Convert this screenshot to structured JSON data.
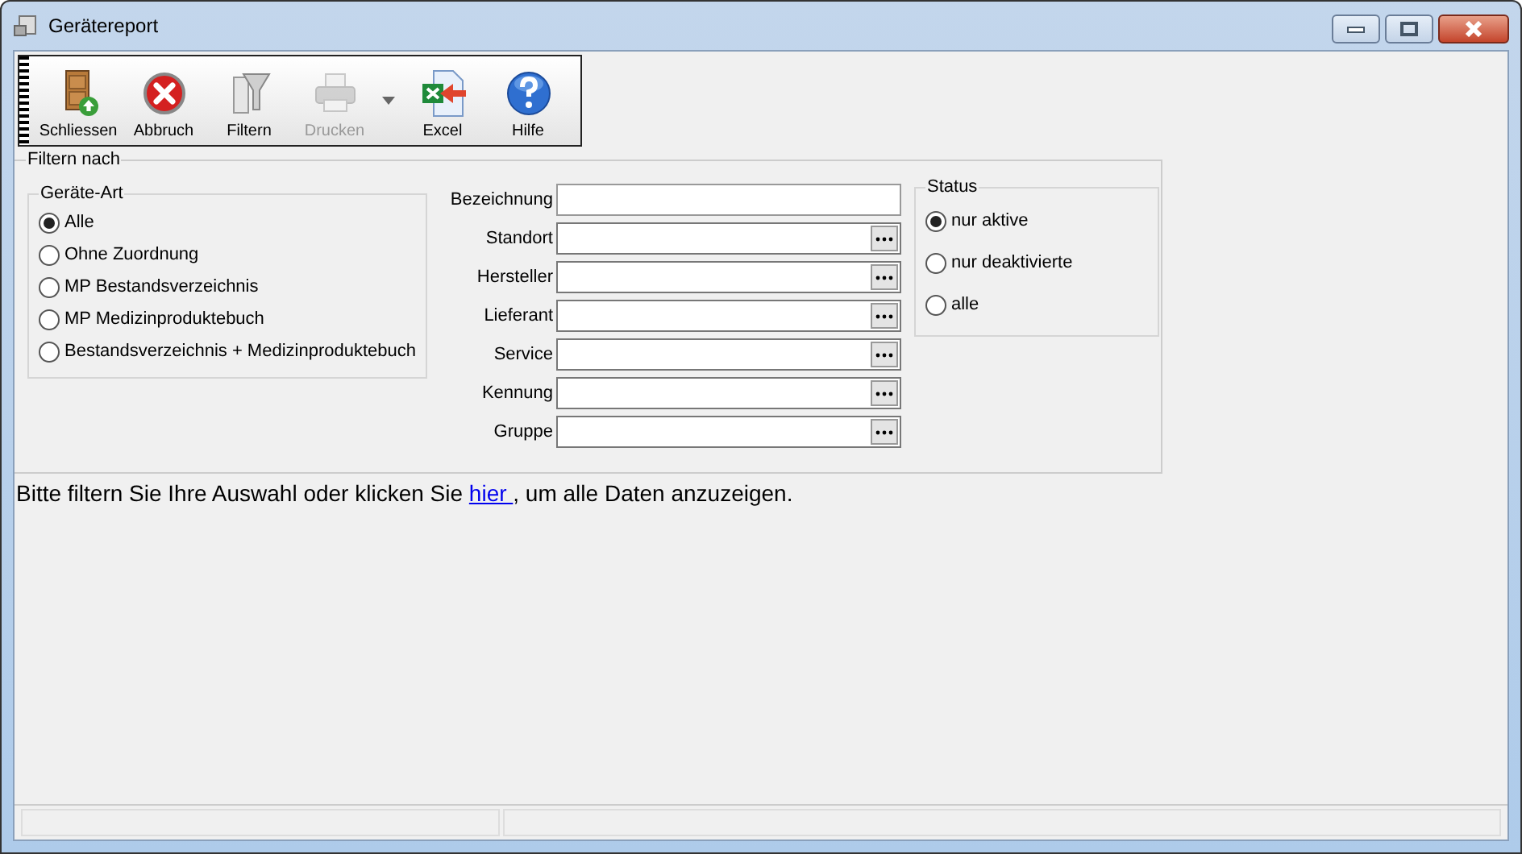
{
  "window": {
    "title": "Gerätereport"
  },
  "toolbar": [
    {
      "label": "Schliessen",
      "kind": "door",
      "disabled": false
    },
    {
      "label": "Abbruch",
      "kind": "cancel",
      "disabled": false
    },
    {
      "label": "Filtern",
      "kind": "filter",
      "disabled": false
    },
    {
      "label": "Drucken",
      "kind": "printer",
      "disabled": true
    },
    {
      "label": "Excel",
      "kind": "excel",
      "disabled": false
    },
    {
      "label": "Hilfe",
      "kind": "help",
      "disabled": false
    }
  ],
  "filter": {
    "title": "Filtern nach",
    "device_type": {
      "title": "Geräte-Art",
      "options": [
        {
          "label": "Alle",
          "selected": true
        },
        {
          "label": "Ohne Zuordnung",
          "selected": false
        },
        {
          "label": "MP Bestandsverzeichnis",
          "selected": false
        },
        {
          "label": "MP Medizinproduktebuch",
          "selected": false
        },
        {
          "label": "Bestandsverzeichnis + Medizinproduktebuch",
          "selected": false
        }
      ]
    },
    "fields": [
      {
        "label": "Bezeichnung",
        "kind": "text"
      },
      {
        "label": "Standort",
        "kind": "lookup"
      },
      {
        "label": "Hersteller",
        "kind": "lookup"
      },
      {
        "label": "Lieferant",
        "kind": "lookup"
      },
      {
        "label": "Service",
        "kind": "lookup"
      },
      {
        "label": "Kennung",
        "kind": "lookup"
      },
      {
        "label": "Gruppe",
        "kind": "lookup"
      }
    ],
    "status": {
      "title": "Status",
      "options": [
        {
          "label": "nur aktive",
          "selected": true
        },
        {
          "label": "nur deaktivierte",
          "selected": false
        },
        {
          "label": "alle",
          "selected": false
        }
      ]
    }
  },
  "message": {
    "before": "Bitte filtern Sie Ihre Auswahl oder klicken Sie ",
    "link": " hier ",
    "after": ", um alle Daten anzuzeigen."
  }
}
